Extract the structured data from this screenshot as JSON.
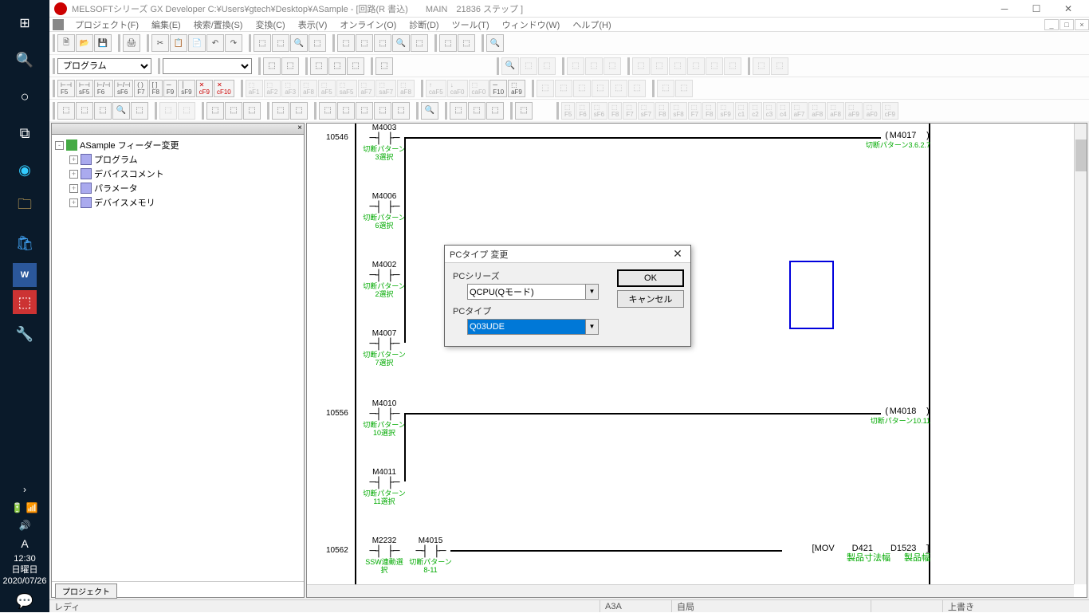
{
  "taskbar": {
    "time": "12:30",
    "day": "日曜日",
    "date": "2020/07/26"
  },
  "app": {
    "title": "MELSOFTシリーズ  GX Developer C:¥Users¥gtech¥Desktop¥ASample - [回路(R 書込)　　MAIN　21836 ステップ ]"
  },
  "menu": {
    "project": "プロジェクト(F)",
    "edit": "編集(E)",
    "search": "検索/置換(S)",
    "convert": "変換(C)",
    "view": "表示(V)",
    "online": "オンライン(O)",
    "diag": "診断(D)",
    "tool": "ツール(T)",
    "window": "ウィンドウ(W)",
    "help": "ヘルプ(H)"
  },
  "combo": {
    "mode": "プログラム"
  },
  "tree": {
    "root": "ASample フィーダー変更",
    "n1": "プログラム",
    "n2": "デバイスコメント",
    "n3": "パラメータ",
    "n4": "デバイスメモリ",
    "tab": "プロジェクト"
  },
  "ladder": {
    "step1": "10546",
    "step2": "10556",
    "step3": "10562",
    "c1d": "M4003",
    "c1c": "切断パターン3選択",
    "c2d": "M4006",
    "c2c": "切断パターン6選択",
    "c3d": "M4002",
    "c3c": "切断パターン2選択",
    "c4d": "M4007",
    "c4c": "切断パターン7選択",
    "c5d": "M4010",
    "c5c": "切断パターン10選択",
    "c6d": "M4011",
    "c6c": "切断パターン11選択",
    "c7d": "M2232",
    "c7c": "SSW連動選択",
    "c8d": "M4015",
    "c8c": "切断パターン8-11",
    "o1d": "M4017",
    "o1c": "切断パターン3.6.2.7",
    "o2d": "M4018",
    "o2c": "切断パターン10.11",
    "mov": "[MOV",
    "movD1": "D421",
    "movC1": "製品寸法幅",
    "movD2": "D1523",
    "movC2": "製品幅"
  },
  "dialog": {
    "title": "PCタイプ 変更",
    "l1": "PCシリーズ",
    "v1": "QCPU(Qモード)",
    "l2": "PCタイプ",
    "v2": "Q03UDE",
    "ok": "OK",
    "cancel": "キャンセル"
  },
  "status": {
    "ready": "レディ",
    "cpu": "A3A",
    "host": "自局",
    "mode": "上書き"
  }
}
